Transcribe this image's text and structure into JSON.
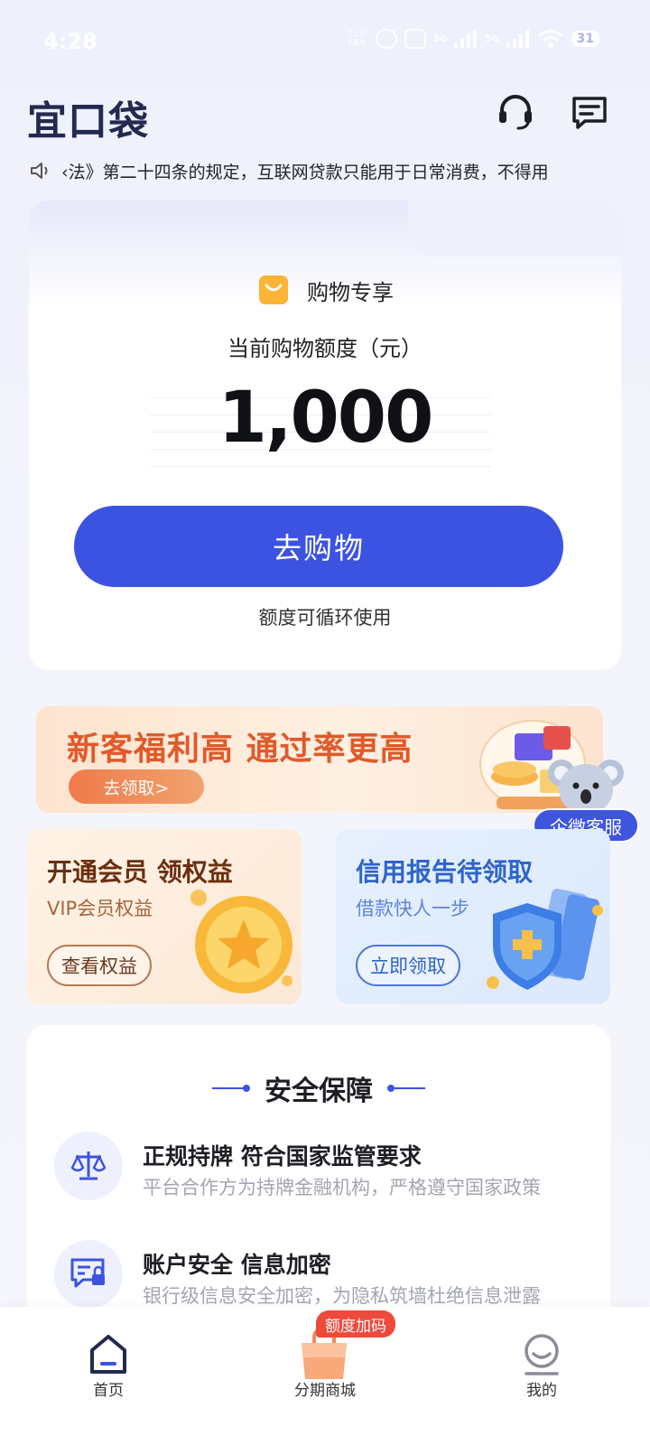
{
  "status_bar": {
    "time": "4:28",
    "net_speed_value": "21.0",
    "net_speed_unit": "KB/s",
    "signal1": "5G",
    "signal2": "5G",
    "battery": "31"
  },
  "header": {
    "logo": "宜口袋",
    "icons": [
      "headset-icon",
      "message-icon"
    ]
  },
  "notice": {
    "text": "‹法》第二十四条的规定，互联网贷款只能用于日常消费，不得用"
  },
  "main_card": {
    "title": "购物专享",
    "limit_label": "当前购物额度（元）",
    "limit_value": "1,000",
    "shop_button": "去购物",
    "note": "额度可循环使用"
  },
  "banner": {
    "title": "新客福利高 通过率更高",
    "button": "去领取>"
  },
  "support": {
    "label": "企微客服"
  },
  "promos": [
    {
      "title": "开通会员 领权益",
      "subtitle": "VIP会员权益",
      "button": "查看权益"
    },
    {
      "title": "信用报告待领取",
      "subtitle": "借款快人一步",
      "button": "立即领取"
    }
  ],
  "security": {
    "heading": "安全保障",
    "items": [
      {
        "title": "正规持牌 符合国家监管要求",
        "desc": "平台合作方为持牌金融机构，严格遵守国家政策"
      },
      {
        "title": "账户安全 信息加密",
        "desc": "银行级信息安全加密，为隐私筑墙杜绝信息泄露"
      }
    ]
  },
  "bottom_nav": {
    "items": [
      {
        "label": "首页",
        "icon": "home-icon"
      },
      {
        "label": "分期商城",
        "icon": "shopping-bag-icon",
        "badge": "额度加码"
      },
      {
        "label": "我的",
        "icon": "profile-icon"
      }
    ]
  },
  "colors": {
    "primary": "#3c53e2",
    "banner_accent": "#e05a2a",
    "badge": "#ee4a3b"
  }
}
